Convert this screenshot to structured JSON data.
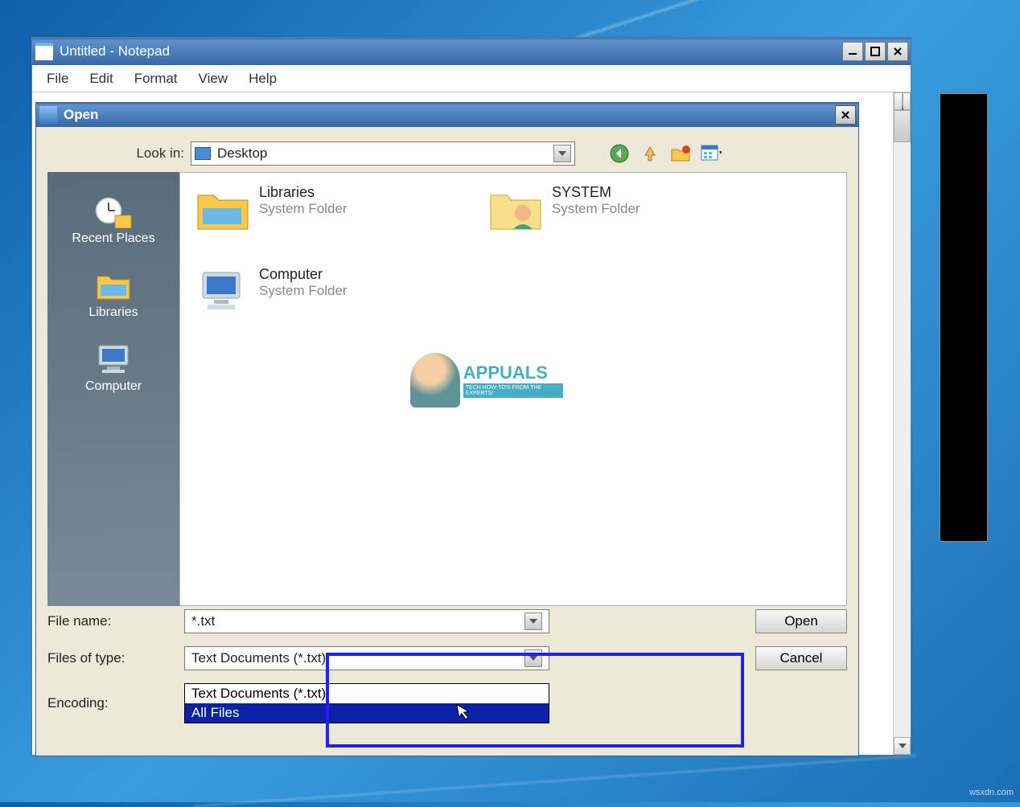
{
  "window": {
    "title": "Untitled - Notepad",
    "menu": {
      "file": "File",
      "edit": "Edit",
      "format": "Format",
      "view": "View",
      "help": "Help"
    }
  },
  "dialog": {
    "title": "Open",
    "lookin_label": "Look in:",
    "lookin_value": "Desktop",
    "places": {
      "recent": "Recent Places",
      "libraries": "Libraries",
      "computer": "Computer"
    },
    "items": [
      {
        "name": "Libraries",
        "type": "System Folder"
      },
      {
        "name": "SYSTEM",
        "type": "System Folder"
      },
      {
        "name": "Computer",
        "type": "System Folder"
      }
    ],
    "filename_label": "File name:",
    "filename_value": "*.txt",
    "filetype_label": "Files of type:",
    "filetype_value": "Text Documents (*.txt)",
    "encoding_label": "Encoding:",
    "open_btn": "Open",
    "cancel_btn": "Cancel",
    "filetype_options": {
      "opt0": "Text Documents (*.txt)",
      "opt1": "All Files"
    }
  },
  "watermark": {
    "title": "APPUALS",
    "subtitle": "TECH HOW-TO'S FROM THE EXPERTS!",
    "source": "wsxdn.com"
  }
}
